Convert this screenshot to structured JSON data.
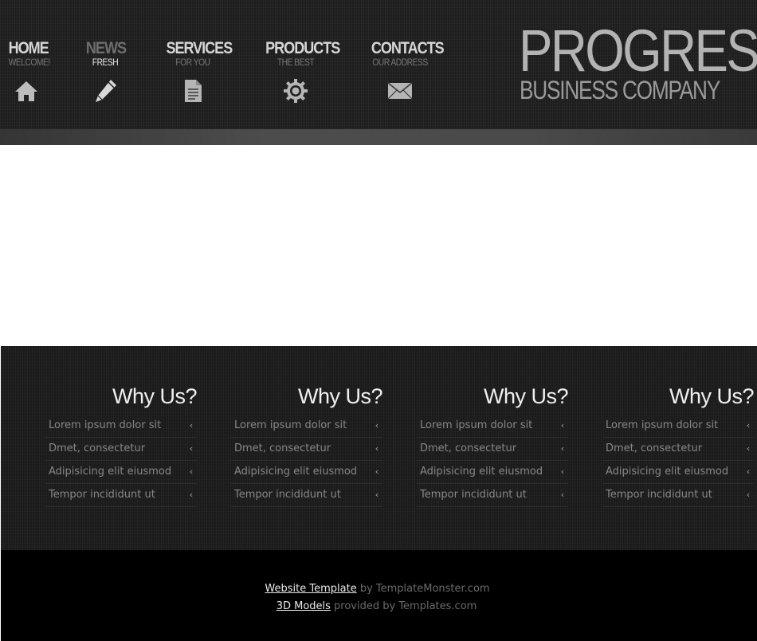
{
  "nav": {
    "items": [
      {
        "title": "HOME",
        "sub": "WELCOME!",
        "icon": "home-icon"
      },
      {
        "title": "NEWS",
        "sub": "FRESH",
        "icon": "pencil-icon",
        "active": true
      },
      {
        "title": "SERVICES",
        "sub": "FOR YOU",
        "icon": "document-icon"
      },
      {
        "title": "PRODUCTS",
        "sub": "THE BEST",
        "icon": "gear-icon"
      },
      {
        "title": "CONTACTS",
        "sub": "OUR ADDRESS",
        "icon": "envelope-icon"
      }
    ]
  },
  "logo": {
    "main": "PROGRESS",
    "sub": "BUSINESS COMPANY"
  },
  "why": {
    "columns": [
      {
        "title": "Why Us?",
        "items": [
          "Lorem ipsum dolor sit",
          "Dmet, consectetur",
          "Adipisicing elit eiusmod",
          "Tempor incididunt ut"
        ]
      },
      {
        "title": "Why Us?",
        "items": [
          "Lorem ipsum dolor sit",
          "Dmet, consectetur",
          "Adipisicing elit eiusmod",
          "Tempor incididunt ut"
        ]
      },
      {
        "title": "Why Us?",
        "items": [
          "Lorem ipsum dolor sit",
          "Dmet, consectetur",
          "Adipisicing elit eiusmod",
          "Tempor incididunt ut"
        ]
      },
      {
        "title": "Why Us?",
        "items": [
          "Lorem ipsum dolor sit",
          "Dmet, consectetur",
          "Adipisicing elit eiusmod",
          "Tempor incididunt ut"
        ]
      }
    ],
    "arrow": "‹"
  },
  "footer": {
    "link1": "Website Template",
    "text1": " by TemplateMonster.com",
    "link2": "3D Models",
    "text2": " provided by Templates.com"
  }
}
